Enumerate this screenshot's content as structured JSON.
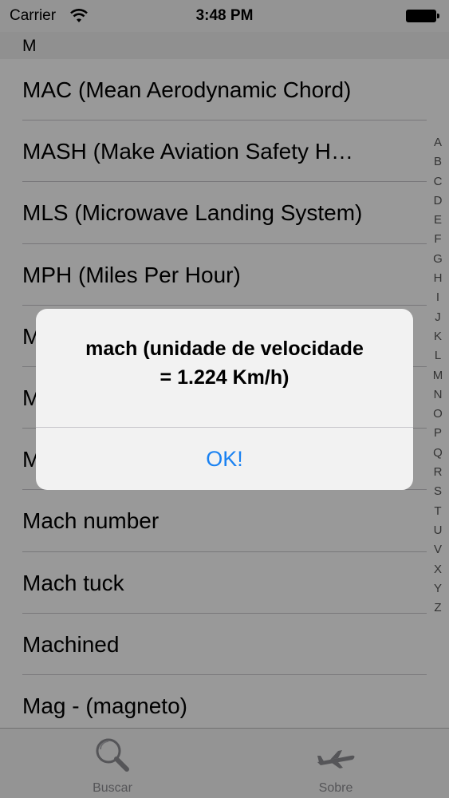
{
  "status_bar": {
    "carrier": "Carrier",
    "time": "3:48 PM",
    "wifi_icon": "wifi-icon",
    "battery_icon": "battery-icon"
  },
  "section_header": "M",
  "list": {
    "items": [
      "MAC (Mean Aerodynamic Chord)",
      "MASH (Make Aviation Safety H…",
      "MLS (Microwave Landing System)",
      "MPH (Miles Per Hour)",
      "M",
      "M",
      "M",
      "Mach number",
      "Mach tuck",
      "Machined",
      "Mag - (magneto)"
    ]
  },
  "index": [
    "A",
    "B",
    "C",
    "D",
    "E",
    "F",
    "G",
    "H",
    "I",
    "J",
    "K",
    "L",
    "M",
    "N",
    "O",
    "P",
    "Q",
    "R",
    "S",
    "T",
    "U",
    "V",
    "X",
    "Y",
    "Z"
  ],
  "tab_bar": {
    "tabs": [
      {
        "label": "Buscar",
        "icon": "magnifier-icon"
      },
      {
        "label": "Sobre",
        "icon": "airplane-icon"
      }
    ]
  },
  "alert": {
    "message_line1": "mach (unidade de velocidade",
    "message_line2": "= 1.224 Km/h)",
    "button_label": "OK!"
  },
  "colors": {
    "accent": "#1a82f2",
    "separator": "#c8c7cc",
    "overlay": "rgba(0,0,0,0.40)"
  }
}
